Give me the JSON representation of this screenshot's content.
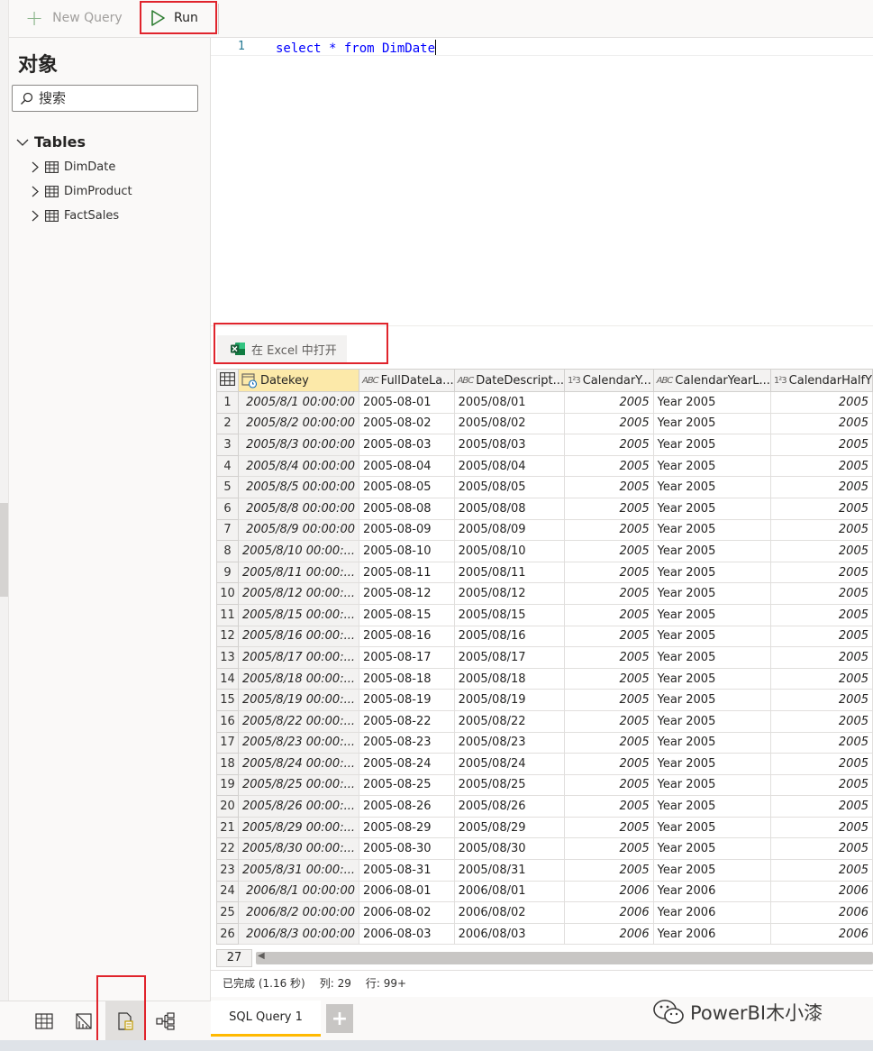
{
  "toolbar": {
    "new_query_label": "New Query",
    "run_label": "Run"
  },
  "explorer": {
    "title": "对象",
    "search_placeholder": "搜索",
    "group_label": "Tables",
    "tables": [
      "DimDate",
      "DimProduct",
      "FactSales"
    ]
  },
  "editor": {
    "line_number": "1",
    "code": "select * from DimDate"
  },
  "results": {
    "excel_label": "在 Excel 中打开",
    "columns": [
      {
        "label": "Datekey",
        "type": "datetime"
      },
      {
        "label": "FullDateLa...",
        "type": "text"
      },
      {
        "label": "DateDescript...",
        "type": "text"
      },
      {
        "label": "CalendarY...",
        "type": "number"
      },
      {
        "label": "CalendarYearL...",
        "type": "text"
      },
      {
        "label": "CalendarHalfY",
        "type": "number"
      }
    ],
    "rows": [
      [
        "1",
        "2005/8/1 00:00:00",
        "2005-08-01",
        "2005/08/01",
        "2005",
        "Year 2005",
        "2005"
      ],
      [
        "2",
        "2005/8/2 00:00:00",
        "2005-08-02",
        "2005/08/02",
        "2005",
        "Year 2005",
        "2005"
      ],
      [
        "3",
        "2005/8/3 00:00:00",
        "2005-08-03",
        "2005/08/03",
        "2005",
        "Year 2005",
        "2005"
      ],
      [
        "4",
        "2005/8/4 00:00:00",
        "2005-08-04",
        "2005/08/04",
        "2005",
        "Year 2005",
        "2005"
      ],
      [
        "5",
        "2005/8/5 00:00:00",
        "2005-08-05",
        "2005/08/05",
        "2005",
        "Year 2005",
        "2005"
      ],
      [
        "6",
        "2005/8/8 00:00:00",
        "2005-08-08",
        "2005/08/08",
        "2005",
        "Year 2005",
        "2005"
      ],
      [
        "7",
        "2005/8/9 00:00:00",
        "2005-08-09",
        "2005/08/09",
        "2005",
        "Year 2005",
        "2005"
      ],
      [
        "8",
        "2005/8/10 00:00:...",
        "2005-08-10",
        "2005/08/10",
        "2005",
        "Year 2005",
        "2005"
      ],
      [
        "9",
        "2005/8/11 00:00:...",
        "2005-08-11",
        "2005/08/11",
        "2005",
        "Year 2005",
        "2005"
      ],
      [
        "10",
        "2005/8/12 00:00:...",
        "2005-08-12",
        "2005/08/12",
        "2005",
        "Year 2005",
        "2005"
      ],
      [
        "11",
        "2005/8/15 00:00:...",
        "2005-08-15",
        "2005/08/15",
        "2005",
        "Year 2005",
        "2005"
      ],
      [
        "12",
        "2005/8/16 00:00:...",
        "2005-08-16",
        "2005/08/16",
        "2005",
        "Year 2005",
        "2005"
      ],
      [
        "13",
        "2005/8/17 00:00:...",
        "2005-08-17",
        "2005/08/17",
        "2005",
        "Year 2005",
        "2005"
      ],
      [
        "14",
        "2005/8/18 00:00:...",
        "2005-08-18",
        "2005/08/18",
        "2005",
        "Year 2005",
        "2005"
      ],
      [
        "15",
        "2005/8/19 00:00:...",
        "2005-08-19",
        "2005/08/19",
        "2005",
        "Year 2005",
        "2005"
      ],
      [
        "16",
        "2005/8/22 00:00:...",
        "2005-08-22",
        "2005/08/22",
        "2005",
        "Year 2005",
        "2005"
      ],
      [
        "17",
        "2005/8/23 00:00:...",
        "2005-08-23",
        "2005/08/23",
        "2005",
        "Year 2005",
        "2005"
      ],
      [
        "18",
        "2005/8/24 00:00:...",
        "2005-08-24",
        "2005/08/24",
        "2005",
        "Year 2005",
        "2005"
      ],
      [
        "19",
        "2005/8/25 00:00:...",
        "2005-08-25",
        "2005/08/25",
        "2005",
        "Year 2005",
        "2005"
      ],
      [
        "20",
        "2005/8/26 00:00:...",
        "2005-08-26",
        "2005/08/26",
        "2005",
        "Year 2005",
        "2005"
      ],
      [
        "21",
        "2005/8/29 00:00:...",
        "2005-08-29",
        "2005/08/29",
        "2005",
        "Year 2005",
        "2005"
      ],
      [
        "22",
        "2005/8/30 00:00:...",
        "2005-08-30",
        "2005/08/30",
        "2005",
        "Year 2005",
        "2005"
      ],
      [
        "23",
        "2005/8/31 00:00:...",
        "2005-08-31",
        "2005/08/31",
        "2005",
        "Year 2005",
        "2005"
      ],
      [
        "24",
        "2006/8/1 00:00:00",
        "2006-08-01",
        "2006/08/01",
        "2006",
        "Year 2006",
        "2006"
      ],
      [
        "25",
        "2006/8/2 00:00:00",
        "2006-08-02",
        "2006/08/02",
        "2006",
        "Year 2006",
        "2006"
      ],
      [
        "26",
        "2006/8/3 00:00:00",
        "2006-08-03",
        "2006/08/03",
        "2006",
        "Year 2006",
        "2006"
      ]
    ],
    "partial_row_number": "27"
  },
  "status": {
    "state": "已完成 (1.16 秒)",
    "columns": "列: 29",
    "rows": "行: 99+"
  },
  "tabs": {
    "active": "SQL Query 1",
    "add": "+"
  },
  "watermark": "PowerBI木小漆",
  "icons": {
    "new_query": "plus-icon",
    "run": "play-icon",
    "search": "search-icon",
    "table": "table-icon",
    "excel": "excel-icon",
    "nav": [
      "data-view-icon",
      "model-view-icon",
      "query-view-icon",
      "lineage-view-icon"
    ]
  },
  "colors": {
    "highlight_box": "#e0242c",
    "datekey_header": "#fce9a9",
    "run_icon": "#2e7d32",
    "excel_green": "#107c41",
    "tab_underline": "#ffb900"
  }
}
